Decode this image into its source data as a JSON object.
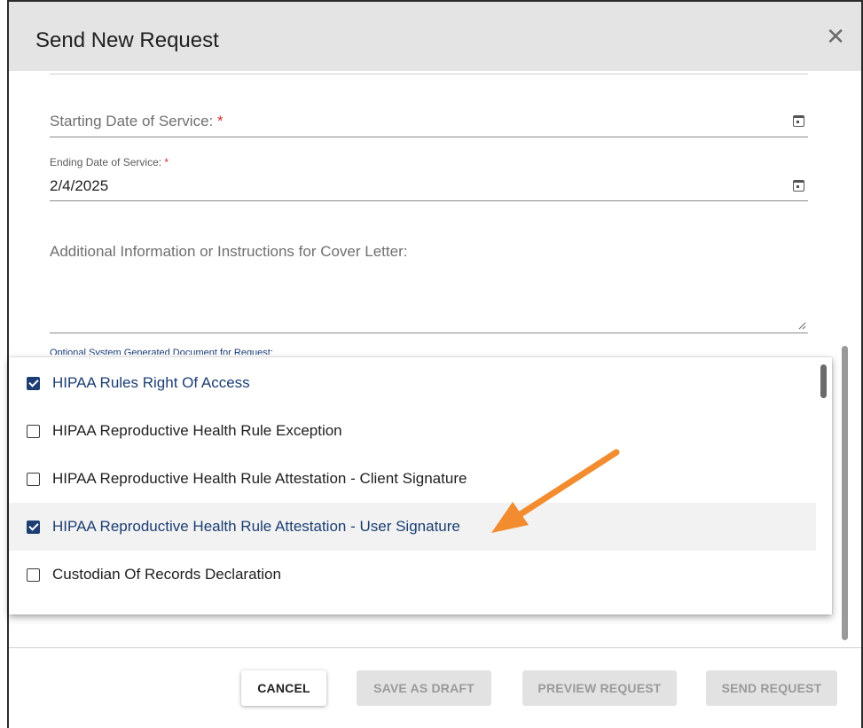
{
  "dialog": {
    "title": "Send New Request",
    "close_icon": "close-icon"
  },
  "fields": {
    "starting_date": {
      "label": "Starting Date of Service:",
      "required": "*",
      "value": ""
    },
    "ending_date": {
      "label": "Ending Date of Service:",
      "required": "*",
      "value": "2/4/2025"
    },
    "additional_info": {
      "placeholder": "Additional Information or Instructions for Cover Letter:"
    }
  },
  "documents": {
    "label": "Optional System Generated Document for Request:",
    "options": [
      {
        "label": "HIPAA Rules Right Of Access",
        "checked": true
      },
      {
        "label": "HIPAA Reproductive Health Rule Exception",
        "checked": false
      },
      {
        "label": "HIPAA Reproductive Health Rule Attestation - Client Signature",
        "checked": false
      },
      {
        "label": "HIPAA Reproductive Health Rule Attestation - User Signature",
        "checked": true
      },
      {
        "label": "Custodian Of Records Declaration",
        "checked": false
      }
    ]
  },
  "buttons": {
    "cancel": "CANCEL",
    "save_draft": "SAVE AS DRAFT",
    "preview": "PREVIEW REQUEST",
    "send": "SEND REQUEST"
  },
  "colors": {
    "accent": "#1c3e73",
    "arrow": "#f28c2e",
    "required": "#d32f2f"
  }
}
